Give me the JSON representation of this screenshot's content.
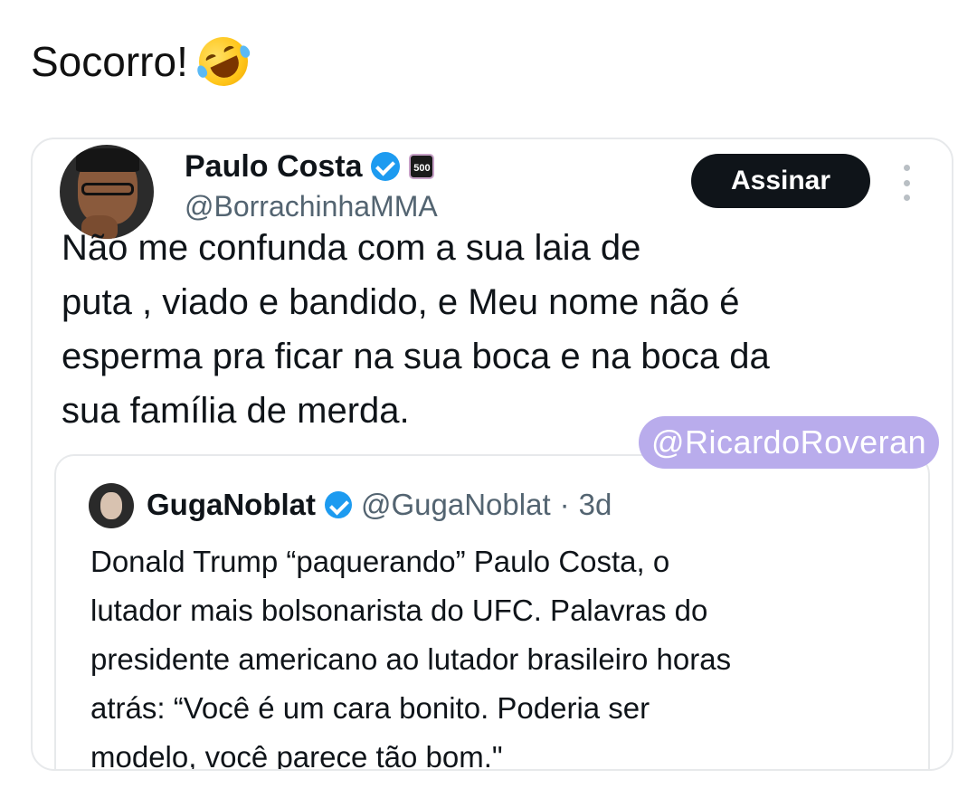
{
  "post": {
    "caption": "Socorro!",
    "caption_emoji": "rolling-on-floor-laughing-emoji"
  },
  "tweet": {
    "author_name": "Paulo Costa",
    "author_handle": "@BorrachinhaMMA",
    "badge_text": "500",
    "subscribe_label": "Assinar",
    "text": "Não me confunda com a sua laia de\nputa , viado e bandido, e Meu nome não é\nesperma pra ficar na sua boca e na boca da\nsua família de merda."
  },
  "watermark": "@RicardoRoveran",
  "quoted": {
    "author_name": "GugaNoblat",
    "author_handle": "@GugaNoblat",
    "separator": "·",
    "age": "3d",
    "text": "Donald Trump “paquerando” Paulo Costa, o\nlutador mais bolsonarista do UFC. Palavras do\npresidente americano ao lutador brasileiro horas\natrás: “Você é um cara bonito. Poderia ser\nmodelo, você parece tão bom.\""
  },
  "colors": {
    "verified": "#1d9bf0",
    "button_bg": "#0f1419",
    "handle": "#536471",
    "watermark_bg": "#b9acec"
  }
}
